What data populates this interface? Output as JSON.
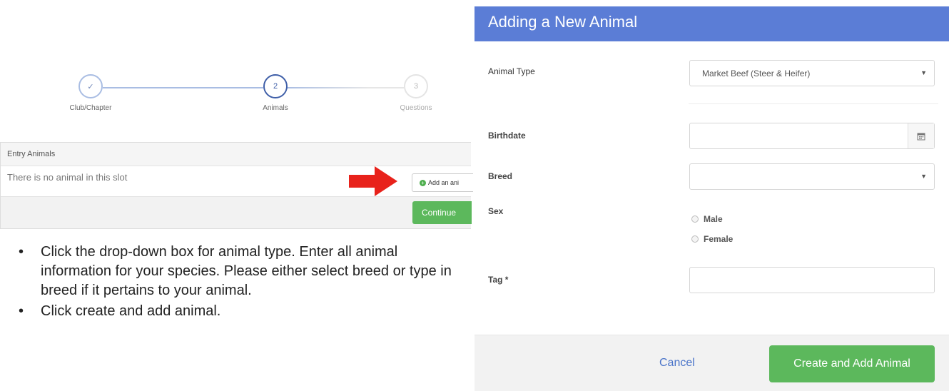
{
  "stepper": {
    "steps": [
      {
        "label": "Club/Chapter",
        "marker": "check-icon"
      },
      {
        "label": "Animals",
        "marker": "2"
      },
      {
        "label": "Questions",
        "marker": "3"
      }
    ]
  },
  "entry_panel": {
    "header": "Entry Animals",
    "empty_text": "There is no animal in this slot",
    "add_button_label": "Add an ani",
    "continue_label": "Continue"
  },
  "instructions": [
    "Click the drop-down box for animal type. Enter all animal information for your species. Please either select breed or type in breed if it pertains to your animal.",
    "Click create and add animal."
  ],
  "modal": {
    "title": "Adding a New Animal",
    "animal_type": {
      "label": "Animal Type",
      "value": "Market Beef (Steer & Heifer)"
    },
    "birthdate": {
      "label": "Birthdate",
      "value": ""
    },
    "breed": {
      "label": "Breed",
      "value": ""
    },
    "sex": {
      "label": "Sex",
      "options": [
        "Male",
        "Female"
      ]
    },
    "tag": {
      "label": "Tag *",
      "value": ""
    },
    "cancel_label": "Cancel",
    "create_label": "Create and Add Animal"
  },
  "colors": {
    "modal_header": "#5b7dd6",
    "success": "#5cb85c",
    "arrow": "#e8221b",
    "stepper_active": "#3f5fa8",
    "link": "#4a74c9"
  }
}
